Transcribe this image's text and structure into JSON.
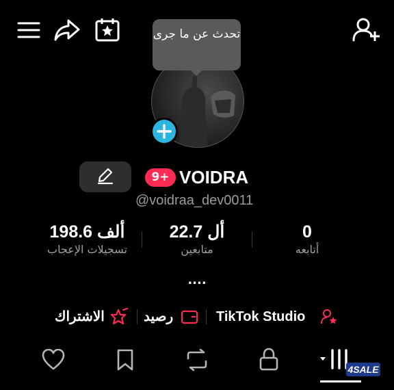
{
  "header": {
    "tooltip_text": "تحدث عن ما جرى",
    "icons": [
      "menu-icon",
      "share-icon",
      "calendar-star-icon",
      "add-friend-icon"
    ]
  },
  "profile": {
    "notifications_badge": "9+",
    "display_name": "VOIDRA",
    "username": "@voidraa_dev0011"
  },
  "stats": [
    {
      "value": "198.6 ألف",
      "label": "تسجيلات الإعجاب"
    },
    {
      "value": "22.7 أل",
      "label": "متابعين"
    },
    {
      "value": "0",
      "label": "أتابعه"
    }
  ],
  "bio_more": "....",
  "links": {
    "subscription": "الاشتراك",
    "balance": "رصيد",
    "studio": "TikTok Studio"
  },
  "tabs": [
    "videos-grid",
    "private-lock",
    "reposts",
    "favorites",
    "liked"
  ],
  "watermark": "4SALE",
  "colors": {
    "accent_red": "#fe2c55",
    "accent_blue": "#2cb4e0",
    "watermark_blue": "#1e3a8a"
  }
}
